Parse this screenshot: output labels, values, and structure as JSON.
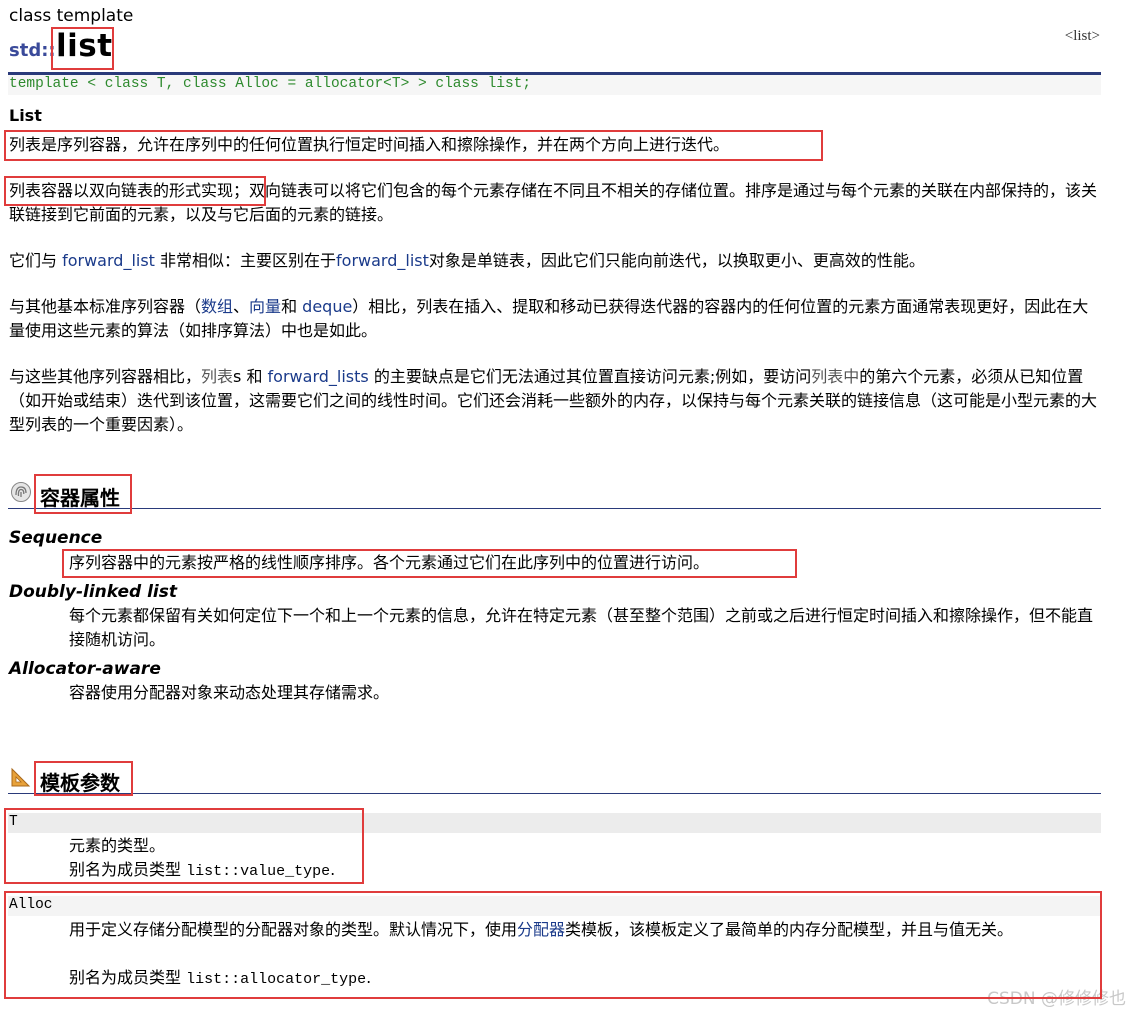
{
  "header": {
    "kind": "class template",
    "namespace": "std::",
    "title": "list",
    "header_link": "<list>"
  },
  "template_decl": "template < class T, class Alloc = allocator<T> > class list;",
  "intro": {
    "heading": "List",
    "p1": "列表是序列容器，允许在序列中的任何位置执行恒定时间插入和擦除操作，并在两个方向上进行迭代。",
    "p2_a": "列表容器以双向链表的形式实现",
    "p2_b": "；双向链表可以将它们包含的每个元素存储在不同且不相关的存储位置。排序是通过与每个元素的关联在内部保持的，该关联链接到它前面的元素，以及与它后面的元素的链接。",
    "p3_a": "它们与 ",
    "p3_link1": "forward_list",
    "p3_b": " 非常相似：主要区别在于",
    "p3_link2": "forward_list",
    "p3_c": "对象是单链表，因此它们只能向前迭代，以换取更小、更高效的性能。",
    "p4_a": "与其他基本标准序列容器（",
    "p4_link1": "数组",
    "p4_sep1": "、",
    "p4_link2": "向量",
    "p4_sep2": "和 ",
    "p4_link3": "deque",
    "p4_b": "）相比，列表在插入、提取和移动已获得迭代器的容器内的任何位置的元素方面通常表现更好，因此在大量使用这些元素的算法（如排序算法）中也是如此。",
    "p5_a": "与这些其他序列容器相比，",
    "p5_code1": "列表",
    "p5_b": "s 和 ",
    "p5_link1": "forward_lists",
    "p5_c": " 的主要缺点是它们无法通过其位置直接访问元素;例如，要访问",
    "p5_code2": "列表中",
    "p5_d": "的第六个元素，必须从已知位置（如开始或结束）迭代到该位置，这需要它们之间的线性时间。它们还会消耗一些额外的内存，以保持与每个元素关联的链接信息（这可能是小型元素的大型列表的一个重要因素）。"
  },
  "container_properties": {
    "heading": "容器属性",
    "items": [
      {
        "term": "Sequence",
        "desc": "序列容器中的元素按严格的线性顺序排序。各个元素通过它们在此序列中的位置进行访问。"
      },
      {
        "term": "Doubly-linked list",
        "desc": "每个元素都保留有关如何定位下一个和上一个元素的信息，允许在特定元素（甚至整个范围）之前或之后进行恒定时间插入和擦除操作，但不能直接随机访问。"
      },
      {
        "term": "Allocator-aware",
        "desc": "容器使用分配器对象来动态处理其存储需求。"
      }
    ]
  },
  "template_params": {
    "heading": "模板参数",
    "T": {
      "name": "T",
      "line1": "元素的类型。",
      "line2_a": "别名为成员类型 ",
      "line2_code": "list::value_type",
      "line2_b": "."
    },
    "Alloc": {
      "name": "Alloc",
      "line1_a": "用于定义存储分配模型的分配器对象的类型。默认情况下，使用",
      "line1_link": "分配器",
      "line1_b": "类模板，该模板定义了最简单的内存分配模型，并且与值无关。",
      "line2_a": "别名为成员类型 ",
      "line2_code": "list::allocator_type",
      "line2_b": "."
    }
  },
  "watermark": "CSDN @修修修也",
  "colors": {
    "highlight_box": "#e03c3c",
    "rule": "#2a3a7a",
    "link": "#1a3a8a",
    "template_green": "#2e8a2e"
  }
}
